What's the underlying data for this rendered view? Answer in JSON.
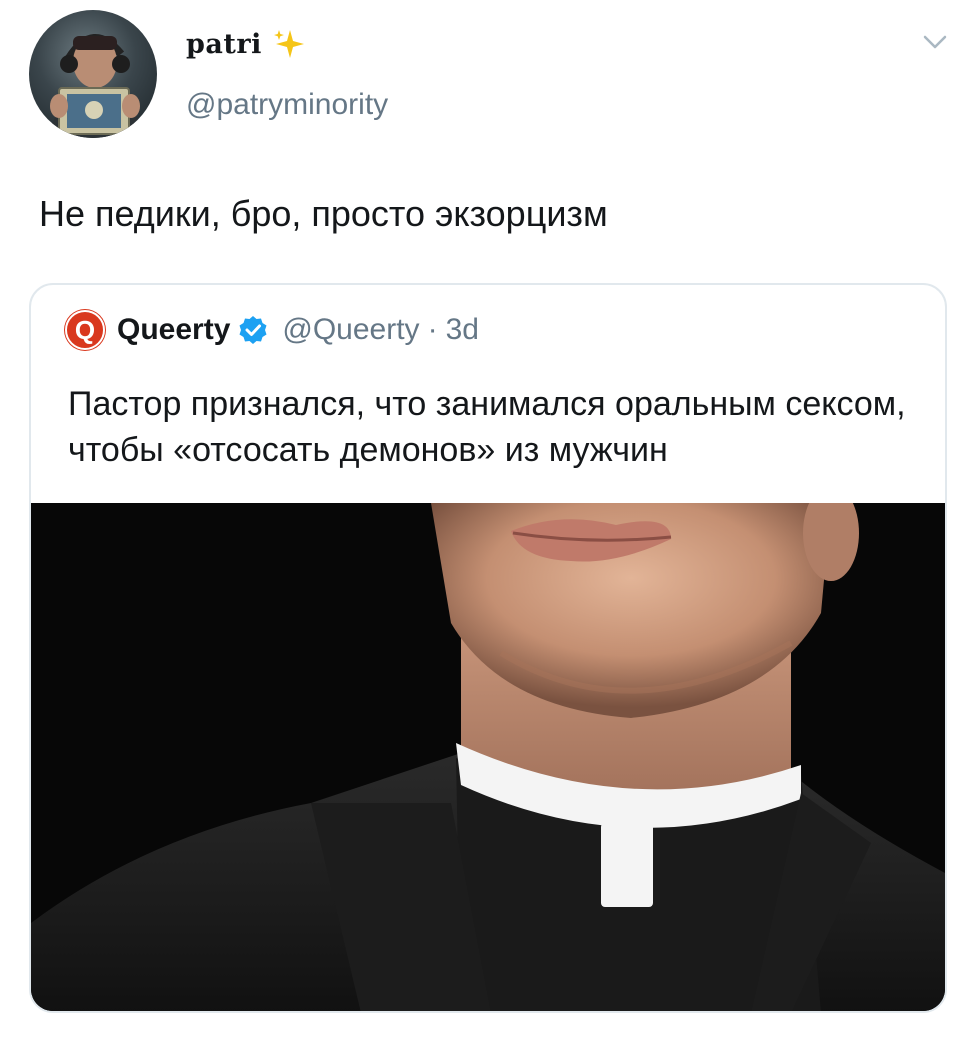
{
  "author": {
    "display_name": "patri",
    "handle": "@patryminority",
    "avatar_icon": "avatar-photo",
    "name_emoji_icon": "sparkle-icon"
  },
  "menu_icon": "chevron-down-icon",
  "tweet": {
    "text": "Не педики, бро, просто экзорцизм"
  },
  "quote": {
    "logo_letter": "Q",
    "name": "Queerty",
    "verified_icon": "verified-badge-icon",
    "handle": "@Queerty",
    "separator": "·",
    "time": "3d",
    "text": "Пастор признался, что занимался оральным сексом, чтобы «отсосать демонов» из мужчин",
    "image_icon": "priest-photo"
  },
  "colors": {
    "text_primary": "#14171a",
    "text_secondary": "#657786",
    "border": "#e1e8ed",
    "verified_blue": "#1da1f2",
    "queerty_red": "#d9381e",
    "sparkle_yellow": "#f5c518"
  }
}
